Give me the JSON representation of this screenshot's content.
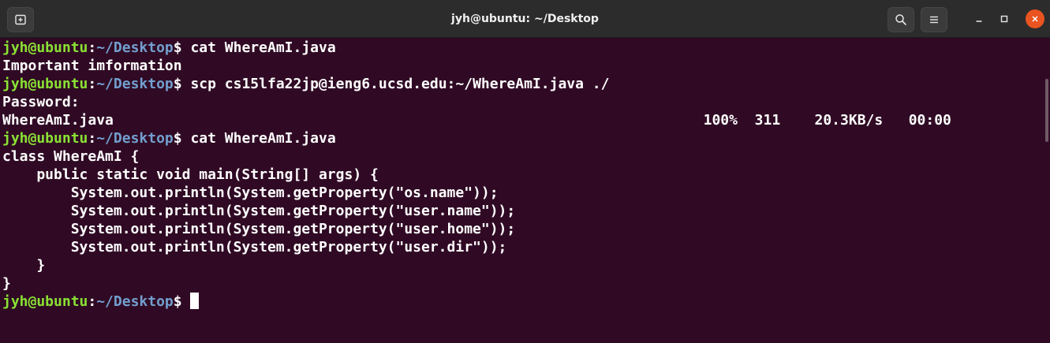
{
  "window": {
    "title": "jyh@ubuntu: ~/Desktop"
  },
  "titlebar": {
    "new_tab_icon": "new-tab-icon",
    "search_icon": "search-icon",
    "menu_icon": "hamburger-menu-icon",
    "minimize_icon": "minimize-icon",
    "maximize_icon": "maximize-icon",
    "close_icon": "close-icon"
  },
  "prompt": {
    "user": "jyh@ubuntu",
    "colon": ":",
    "path": "~/Desktop",
    "symbol": "$ "
  },
  "terminal": {
    "lines": [
      {
        "type": "prompt",
        "command": "cat WhereAmI.java"
      },
      {
        "type": "output",
        "text": "Important imformation"
      },
      {
        "type": "prompt",
        "command": "scp cs15lfa22jp@ieng6.ucsd.edu:~/WhereAmI.java ./"
      },
      {
        "type": "output",
        "text": "Password: "
      },
      {
        "type": "output",
        "text": "WhereAmI.java                                                                     100%  311    20.3KB/s   00:00"
      },
      {
        "type": "prompt",
        "command": "cat WhereAmI.java"
      },
      {
        "type": "output",
        "text": "class WhereAmI {"
      },
      {
        "type": "output",
        "text": "    public static void main(String[] args) {"
      },
      {
        "type": "output",
        "text": "        System.out.println(System.getProperty(\"os.name\"));"
      },
      {
        "type": "output",
        "text": "        System.out.println(System.getProperty(\"user.name\"));"
      },
      {
        "type": "output",
        "text": "        System.out.println(System.getProperty(\"user.home\"));"
      },
      {
        "type": "output",
        "text": "        System.out.println(System.getProperty(\"user.dir\"));"
      },
      {
        "type": "output",
        "text": "    }"
      },
      {
        "type": "output",
        "text": "}"
      },
      {
        "type": "prompt",
        "command": "",
        "cursor": true
      }
    ]
  },
  "colors": {
    "background": "#300a24",
    "titlebar": "#2c2c2c",
    "user": "#8ae234",
    "path": "#729fcf",
    "text": "#ffffff",
    "close_button": "#e95420"
  }
}
